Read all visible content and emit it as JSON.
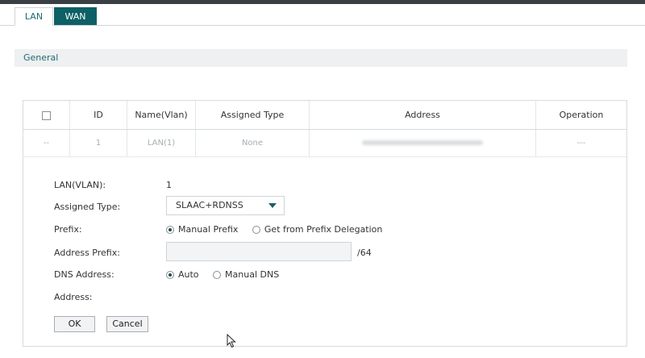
{
  "tabs": [
    {
      "label": "LAN",
      "active": true
    },
    {
      "label": "WAN",
      "active": false
    }
  ],
  "section": {
    "title": "General"
  },
  "table": {
    "headers": [
      "",
      "ID",
      "Name(Vlan)",
      "Assigned Type",
      "Address",
      "Operation"
    ],
    "row": {
      "check": "--",
      "id": "1",
      "name": "LAN(1)",
      "assigned_type": "None",
      "address": "",
      "operation": "---"
    }
  },
  "form": {
    "lan_vlan_label": "LAN(VLAN):",
    "lan_vlan_value": "1",
    "assigned_type_label": "Assigned Type:",
    "assigned_type_value": "SLAAC+RDNSS",
    "prefix_label": "Prefix:",
    "prefix_options": [
      "Manual Prefix",
      "Get from Prefix Delegation"
    ],
    "prefix_selected": "Manual Prefix",
    "address_prefix_label": "Address Prefix:",
    "address_prefix_value": "",
    "address_prefix_suffix": "/64",
    "dns_label": "DNS Address:",
    "dns_options": [
      "Auto",
      "Manual DNS"
    ],
    "dns_selected": "Auto",
    "address_label": "Address:",
    "ok_label": "OK",
    "cancel_label": "Cancel"
  },
  "colors": {
    "accent": "#0e5f66",
    "top_bar": "#3a3f44",
    "section_bg": "#eef0f1"
  }
}
